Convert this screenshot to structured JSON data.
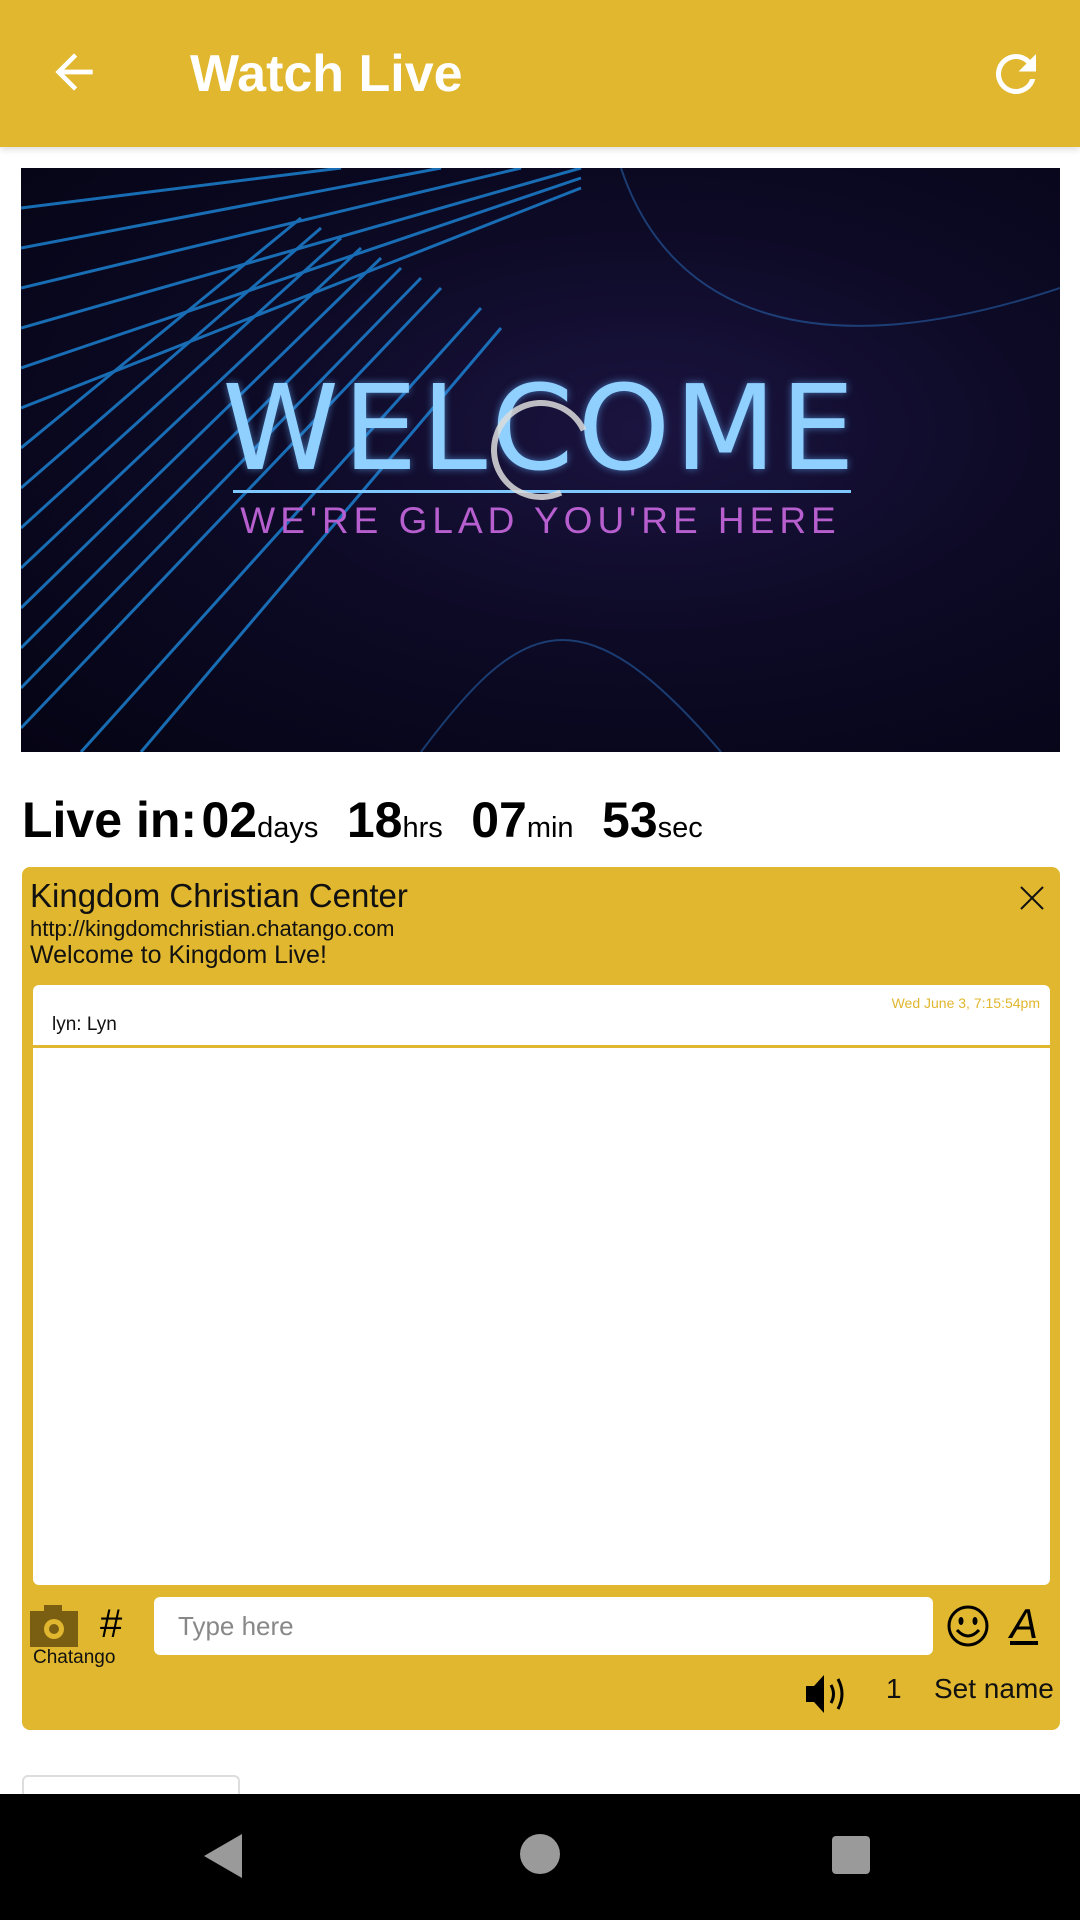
{
  "header": {
    "title": "Watch Live",
    "back_icon": "arrow-left-icon",
    "refresh_icon": "refresh-icon",
    "color": "#E0B72E"
  },
  "video": {
    "headline": "WELCOME",
    "subline": "WE'RE GLAD YOU'RE HERE",
    "state": "loading"
  },
  "countdown": {
    "label": "Live in:",
    "days": "02",
    "days_unit": "days",
    "hours": "18",
    "hours_unit": "hrs",
    "minutes": "07",
    "minutes_unit": "min",
    "seconds": "53",
    "seconds_unit": "sec"
  },
  "chat": {
    "title": "Kingdom Christian Center",
    "url": "http://kingdomchristian.chatango.com",
    "welcome": "Welcome to Kingdom Live!",
    "messages": [
      {
        "time": "Wed June 3, 7:15:54pm",
        "text": "lyn: Lyn"
      }
    ],
    "input_placeholder": "Type here",
    "brand": "Chatango",
    "user_count": "1",
    "set_name_label": "Set name"
  }
}
